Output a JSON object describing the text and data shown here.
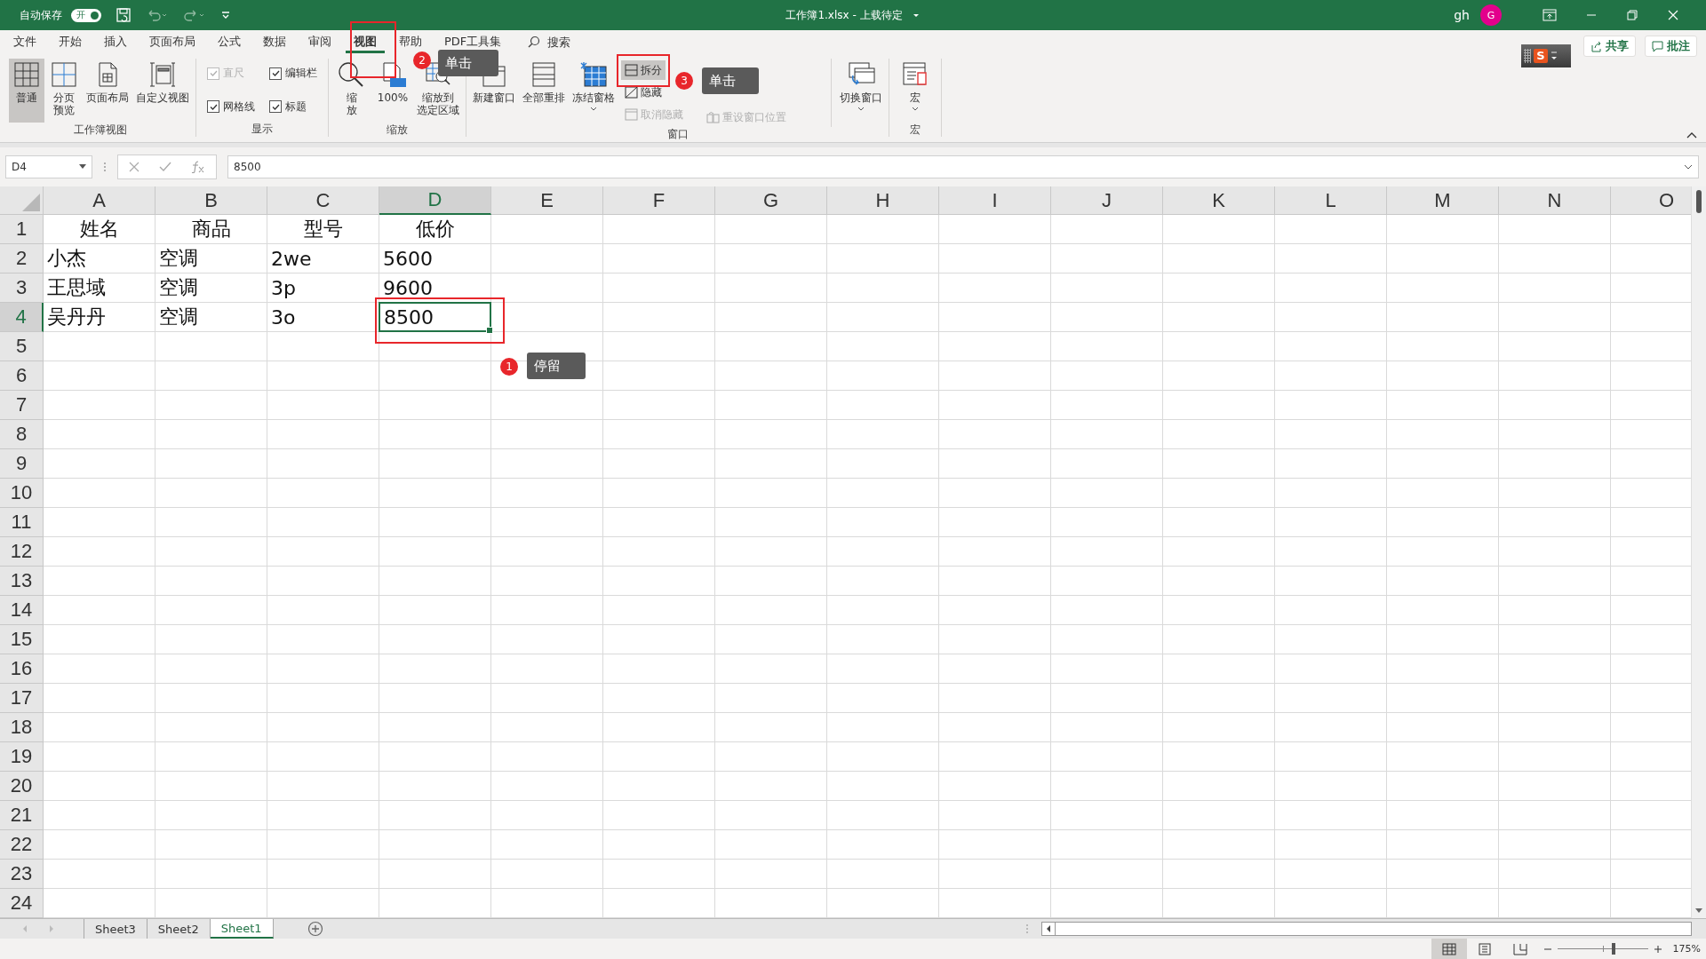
{
  "title_bar": {
    "autosave_label": "自动保存",
    "autosave_toggle": {
      "label": "开",
      "on": true
    },
    "title": "工作簿1.xlsx  -  上载待定",
    "user": "gh",
    "avatar": "G"
  },
  "menu_tabs": [
    {
      "label": "文件",
      "selected": false
    },
    {
      "label": "开始",
      "selected": false
    },
    {
      "label": "插入",
      "selected": false
    },
    {
      "label": "页面布局",
      "selected": false
    },
    {
      "label": "公式",
      "selected": false
    },
    {
      "label": "数据",
      "selected": false
    },
    {
      "label": "审阅",
      "selected": false
    },
    {
      "label": "视图",
      "selected": true
    },
    {
      "label": "帮助",
      "selected": false
    },
    {
      "label": "PDF工具集",
      "selected": false
    }
  ],
  "search": {
    "label": "搜索"
  },
  "share_button": "共享",
  "comments_button": "批注",
  "ime_toolbar": {
    "logo": "S"
  },
  "ribbon": {
    "workbook_views": {
      "label": "工作簿视图",
      "buttons": [
        {
          "lines": [
            "普通"
          ],
          "selected": true
        },
        {
          "lines": [
            "分页",
            "预览"
          ],
          "selected": false
        },
        {
          "lines": [
            "页面布局"
          ],
          "selected": false
        },
        {
          "lines": [
            "自定义视图"
          ],
          "selected": false
        }
      ]
    },
    "display": {
      "label": "显示",
      "checks": [
        {
          "label": "直尺",
          "checked": true,
          "disabled": true
        },
        {
          "label": "编辑栏",
          "checked": true,
          "disabled": false
        },
        {
          "label": "网格线",
          "checked": true,
          "disabled": false
        },
        {
          "label": "标题",
          "checked": true,
          "disabled": false
        }
      ]
    },
    "zoom": {
      "label": "缩放",
      "buttons": [
        {
          "lines": [
            "缩",
            "放"
          ]
        },
        {
          "lines": [
            "100%"
          ]
        },
        {
          "lines": [
            "缩放到",
            "选定区域"
          ]
        }
      ]
    },
    "window": {
      "label": "窗口",
      "buttons": [
        {
          "lines": [
            "新建窗口"
          ]
        },
        {
          "lines": [
            "全部重排"
          ]
        },
        {
          "lines": [
            "冻结窗格"
          ]
        }
      ],
      "small": [
        {
          "label": "拆分",
          "selected": true,
          "disabled": false
        },
        {
          "label": "隐藏",
          "selected": false,
          "disabled": false
        },
        {
          "label": "取消隐藏",
          "selected": false,
          "disabled": true
        }
      ],
      "reset": {
        "label": "重设窗口位置",
        "disabled": true
      },
      "switch": {
        "lines": [
          "切换窗口"
        ]
      }
    },
    "macros": {
      "label": "宏",
      "button": {
        "lines": [
          "宏"
        ]
      }
    }
  },
  "formula_bar": {
    "name_box": "D4",
    "value": "8500"
  },
  "sheet": {
    "columns": [
      {
        "label": "A",
        "selected": false
      },
      {
        "label": "B",
        "selected": false
      },
      {
        "label": "C",
        "selected": false
      },
      {
        "label": "D",
        "selected": true
      },
      {
        "label": "E",
        "selected": false
      },
      {
        "label": "F",
        "selected": false
      },
      {
        "label": "G",
        "selected": false
      },
      {
        "label": "H",
        "selected": false
      },
      {
        "label": "I",
        "selected": false
      },
      {
        "label": "J",
        "selected": false
      },
      {
        "label": "K",
        "selected": false
      },
      {
        "label": "L",
        "selected": false
      },
      {
        "label": "M",
        "selected": false
      },
      {
        "label": "N",
        "selected": false
      },
      {
        "label": "O",
        "selected": false
      }
    ],
    "header_row": {
      "label": "1",
      "selected": false,
      "cells": [
        "姓名",
        "商品",
        "型号",
        "低价"
      ]
    },
    "rows": [
      {
        "label": "2",
        "selected": false,
        "cells": [
          {
            "text": "小杰",
            "selected": false
          },
          {
            "text": "空调",
            "selected": false
          },
          {
            "text": "2we",
            "selected": false
          },
          {
            "text": "5600",
            "selected": false
          }
        ]
      },
      {
        "label": "3",
        "selected": false,
        "cells": [
          {
            "text": "王思域",
            "selected": false
          },
          {
            "text": "空调",
            "selected": false
          },
          {
            "text": "3p",
            "selected": false
          },
          {
            "text": "9600",
            "selected": false
          }
        ]
      },
      {
        "label": "4",
        "selected": true,
        "cells": [
          {
            "text": "吴丹丹",
            "selected": false
          },
          {
            "text": "空调",
            "selected": false
          },
          {
            "text": "3o",
            "selected": false
          },
          {
            "text": "8500",
            "selected": true
          }
        ]
      },
      {
        "label": "5",
        "selected": false
      },
      {
        "label": "6",
        "selected": false
      },
      {
        "label": "7",
        "selected": false
      },
      {
        "label": "8",
        "selected": false
      },
      {
        "label": "9",
        "selected": false
      },
      {
        "label": "10",
        "selected": false
      },
      {
        "label": "11",
        "selected": false
      },
      {
        "label": "12",
        "selected": false
      },
      {
        "label": "13",
        "selected": false
      },
      {
        "label": "14",
        "selected": false
      },
      {
        "label": "15",
        "selected": false
      },
      {
        "label": "16",
        "selected": false
      },
      {
        "label": "17",
        "selected": false
      },
      {
        "label": "18",
        "selected": false
      },
      {
        "label": "19",
        "selected": false
      },
      {
        "label": "20",
        "selected": false
      },
      {
        "label": "21",
        "selected": false
      },
      {
        "label": "22",
        "selected": false
      },
      {
        "label": "23",
        "selected": false
      },
      {
        "label": "24",
        "selected": false
      }
    ]
  },
  "sheet_tabs": [
    {
      "label": "Sheet3",
      "selected": false
    },
    {
      "label": "Sheet2",
      "selected": false
    },
    {
      "label": "Sheet1",
      "selected": true
    }
  ],
  "status_bar": {
    "views": [
      {
        "selected": true
      },
      {
        "selected": false
      },
      {
        "selected": false
      }
    ],
    "zoom_slider": {
      "level": 0.62
    },
    "zoom": "175%"
  },
  "annotations": [
    {
      "number": "1",
      "text": "停留"
    },
    {
      "number": "2",
      "text": "单击"
    },
    {
      "number": "3",
      "text": "单击"
    }
  ]
}
